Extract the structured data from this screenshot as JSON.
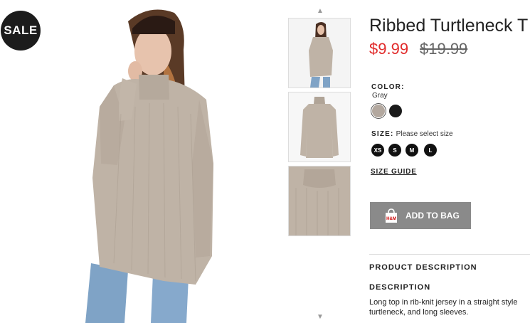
{
  "badge": {
    "sale_label": "SALE"
  },
  "product": {
    "title": "Ribbed Turtleneck T",
    "price": "$9.99",
    "old_price": "$19.99"
  },
  "color": {
    "label": "COLOR:",
    "selected": "Gray",
    "swatches": [
      {
        "name": "Gray",
        "hex": "#b3a89f"
      },
      {
        "name": "Black",
        "hex": "#1a1a1a"
      }
    ]
  },
  "size": {
    "label": "SIZE:",
    "hint": "Please select size",
    "options": [
      "XS",
      "S",
      "M",
      "L"
    ]
  },
  "size_guide": "SIZE GUIDE",
  "add_to_bag": {
    "label": "ADD TO BAG",
    "icon": "shopping-bag-icon",
    "bag_text": "H&M"
  },
  "product_description": {
    "heading": "PRODUCT DESCRIPTION",
    "subheading": "DESCRIPTION",
    "text": "Long top in rib-knit jersey in a straight style turtleneck, and long sleeves."
  },
  "thumbnails": {
    "up_arrow": "▲",
    "down_arrow": "▼"
  },
  "colors": {
    "price_red": "#e12c2c",
    "button_gray": "#8a8a8a",
    "sweater": "#bfb3a6"
  }
}
